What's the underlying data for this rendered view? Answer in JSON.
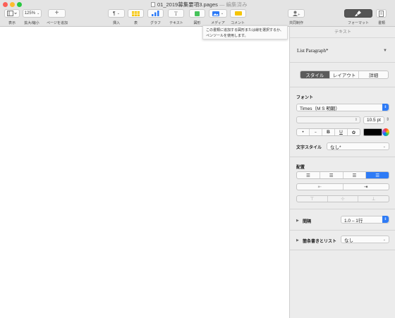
{
  "window": {
    "title": "01_2019募集要項3.pages",
    "edited": " — 編集済み"
  },
  "toolbar": {
    "view": {
      "label": "表示"
    },
    "zoom": {
      "value": "125%",
      "label": "拡大/縮小"
    },
    "add_page": {
      "label": "ページを追加"
    },
    "insert": {
      "label": "挿入"
    },
    "table": {
      "label": "表"
    },
    "chart": {
      "label": "グラフ"
    },
    "text": {
      "label": "テキスト"
    },
    "shape": {
      "label": "図形"
    },
    "media": {
      "label": "メディア"
    },
    "comment": {
      "label": "コメント"
    },
    "collaborate": {
      "label": "共同制作"
    },
    "format": {
      "label": "フォーマット"
    },
    "document": {
      "label": "書類"
    }
  },
  "tooltip": {
    "text": "この書類に追加する図形または線を選択するか、ペンツールを使用します。"
  },
  "inspector": {
    "header": "テキスト",
    "paragraph_style": "List Paragraph*",
    "tabs": [
      "スタイル",
      "レイアウト",
      "詳細"
    ],
    "font_section": "フォント",
    "font_name": "Times（M S 明朝）",
    "font_size": "10.5 pt",
    "style_buttons": [
      "•",
      "˶",
      "B",
      "U",
      "✿"
    ],
    "char_style_label": "文字スタイル",
    "char_style_value": "なし*",
    "alignment_label": "配置",
    "spacing_label": "間隔",
    "spacing_value": "1.0 – 1行",
    "bullets_label": "箇条書きとリスト",
    "bullets_value": "なし"
  },
  "colors": {
    "toolbar_bg": "#e4e4e4",
    "inspector_bg": "#ececec",
    "selected_segment": "#5b5b5b",
    "accent_blue": "#2e7bf6",
    "text_color_swatch": "#000000"
  }
}
